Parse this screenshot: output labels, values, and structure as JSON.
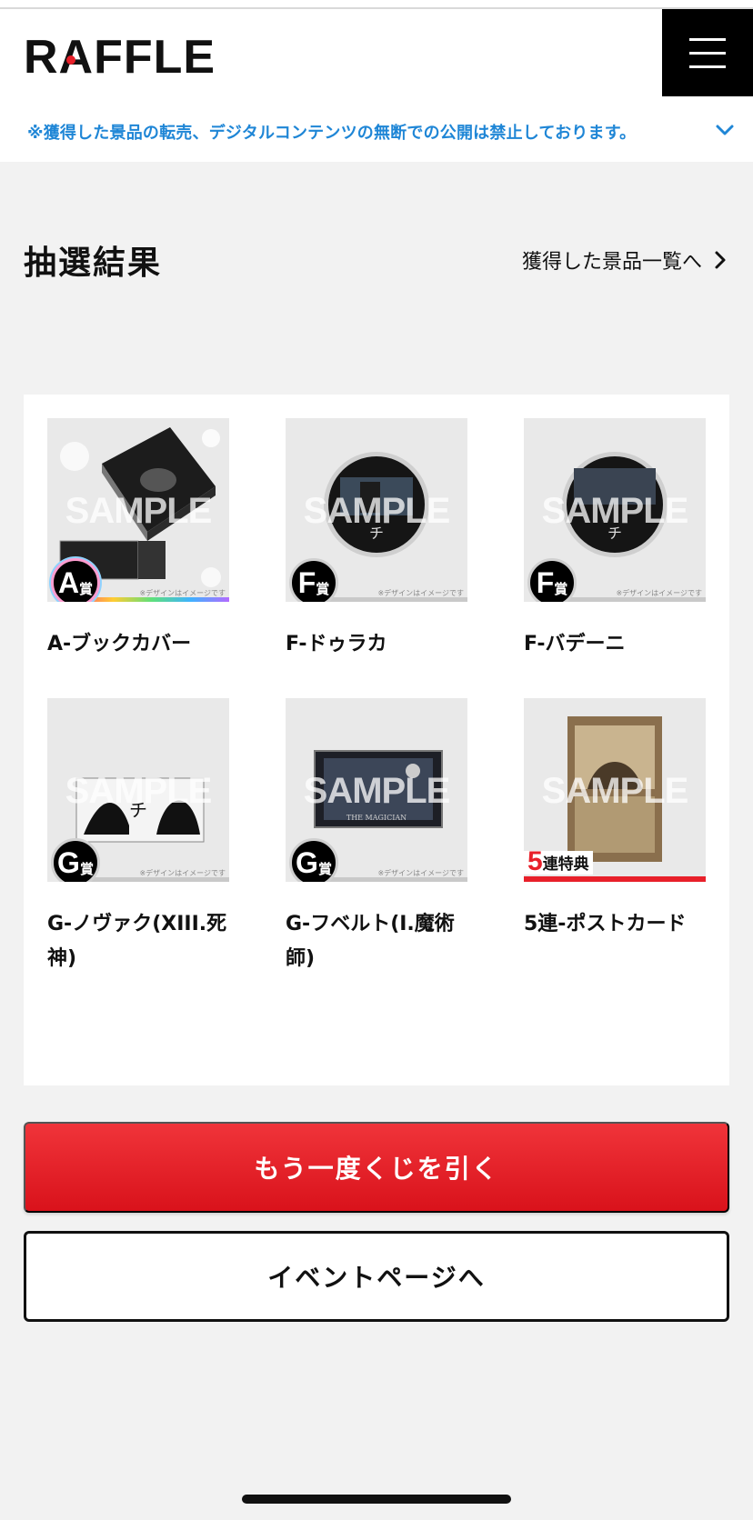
{
  "header": {
    "logo_text": "RAFFLE",
    "menu_icon": "hamburger-menu-icon",
    "notice": "※獲得した景品の転売、デジタルコンテンツの無断での公開は禁止しております。"
  },
  "section": {
    "title": "抽選結果",
    "prize_link_label": "獲得した景品一覧へ"
  },
  "items": [
    {
      "name": "A-ブックカバー",
      "badge_letter": "A",
      "badge_sub": "賞",
      "watermark": "SAMPLE",
      "disclaimer": "※デザインはイメージです"
    },
    {
      "name": "F-ドゥラカ",
      "badge_letter": "F",
      "badge_sub": "賞",
      "watermark": "SAMPLE",
      "disclaimer": "※デザインはイメージです"
    },
    {
      "name": "F-バデーニ",
      "badge_letter": "F",
      "badge_sub": "賞",
      "watermark": "SAMPLE",
      "disclaimer": "※デザインはイメージです"
    },
    {
      "name": "G-ノヴァク(XIII.死神)",
      "badge_letter": "G",
      "badge_sub": "賞",
      "watermark": "SAMPLE",
      "disclaimer": "※デザインはイメージです"
    },
    {
      "name": "G-フベルト(I.魔術師)",
      "badge_letter": "G",
      "badge_sub": "賞",
      "watermark": "SAMPLE",
      "disclaimer": "※デザインはイメージです"
    },
    {
      "name": "5連-ポストカード",
      "bonus_number": "5",
      "bonus_label": "連特典",
      "watermark": "SAMPLE"
    }
  ],
  "buttons": {
    "draw_again": "もう一度くじを引く",
    "event_page": "イベントページへ"
  },
  "colors": {
    "accent_red": "#e8202a",
    "notice_blue": "#1f86d6",
    "background": "#f2f2f2"
  }
}
